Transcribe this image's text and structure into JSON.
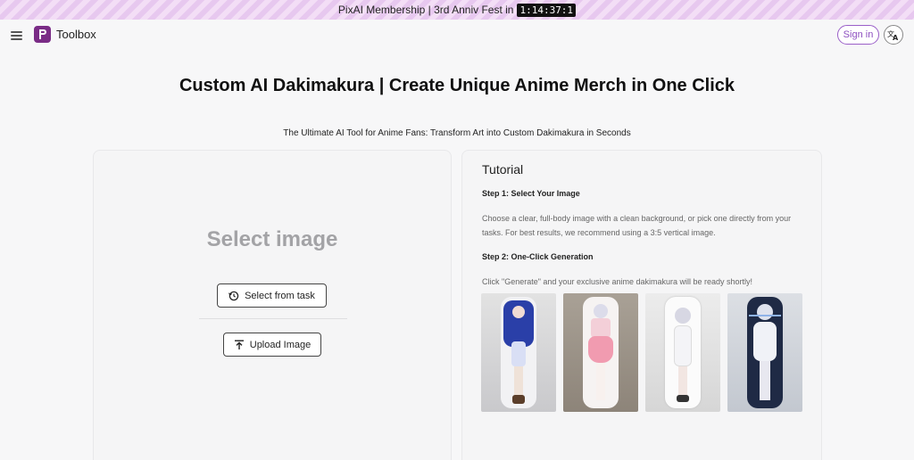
{
  "promo": {
    "text": "PixAI Membership | 3rd Anniv Fest in",
    "countdown": "1:14:37:1"
  },
  "nav": {
    "logo_text": "Toolbox",
    "signin": "Sign in",
    "menu_icon": "hamburger-menu-icon",
    "lang_icon": "translate-icon"
  },
  "page": {
    "title": "Custom AI Dakimakura | Create Unique Anime Merch in One Click",
    "subtitle": "The Ultimate AI Tool for Anime Fans: Transform Art into Custom Dakimakura in Seconds"
  },
  "upload": {
    "placeholder": "Select image",
    "select_task_label": "Select from task",
    "upload_label": "Upload Image",
    "select_task_icon": "history-icon",
    "upload_icon": "upload-icon"
  },
  "tutorial": {
    "title": "Tutorial",
    "step1_title": "Step 1: Select Your Image",
    "step1_text": "Choose a clear, full-body image with a clean background, or pick one directly from your tasks. For best results, we recommend using a 3:5 vertical image.",
    "step2_title": "Step 2: One-Click Generation",
    "step2_text": "Click \"Generate\" and your exclusive anime dakimakura will be ready shortly!"
  },
  "colors": {
    "brand": "#7a2c86",
    "accent": "#8d4fc0",
    "placeholder": "#a3a3a6"
  }
}
